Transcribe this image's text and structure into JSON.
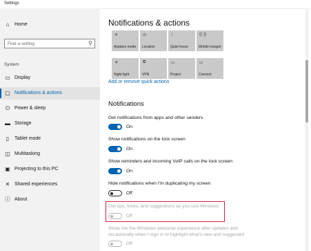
{
  "window": {
    "title": "Settings"
  },
  "sidebar": {
    "home": {
      "label": "Home",
      "icon": "home-icon"
    },
    "search": {
      "placeholder": "Find a setting",
      "icon": "search-icon"
    },
    "section": "System",
    "items": [
      {
        "label": "Display",
        "icon": "display-icon"
      },
      {
        "label": "Notifications & actions",
        "icon": "notifications-icon",
        "selected": true
      },
      {
        "label": "Power & sleep",
        "icon": "power-icon"
      },
      {
        "label": "Storage",
        "icon": "storage-icon"
      },
      {
        "label": "Tablet mode",
        "icon": "tablet-mode-icon"
      },
      {
        "label": "Multitasking",
        "icon": "multitasking-icon"
      },
      {
        "label": "Projecting to this PC",
        "icon": "projecting-icon"
      },
      {
        "label": "Shared experiences",
        "icon": "shared-experiences-icon"
      },
      {
        "label": "About",
        "icon": "about-icon"
      }
    ]
  },
  "main": {
    "title": "Notifications & actions",
    "quick_actions": [
      {
        "label": "Airplane mode",
        "icon": "airplane-icon"
      },
      {
        "label": "Location",
        "icon": "location-icon"
      },
      {
        "label": "Quiet hours",
        "icon": "moon-icon"
      },
      {
        "label": "Mobile hotspot",
        "icon": "hotspot-icon"
      },
      {
        "label": "Night light",
        "icon": "night-light-icon"
      },
      {
        "label": "VPN",
        "icon": "vpn-icon"
      },
      {
        "label": "Project",
        "icon": "project-icon"
      },
      {
        "label": "Connect",
        "icon": "connect-icon"
      }
    ],
    "quick_actions_link": "Add or remove quick actions",
    "notifications_heading": "Notifications",
    "settings": [
      {
        "label": "Get notifications from apps and other senders",
        "state": "On"
      },
      {
        "label": "Show notifications on the lock screen",
        "state": "On"
      },
      {
        "label": "Show reminders and incoming VoIP calls on the lock screen",
        "state": "On"
      },
      {
        "label": "Hide notifications when I'm duplicating my screen",
        "state": "Off"
      },
      {
        "label": "Get tips, tricks, and suggestions as you use Windows",
        "state": "Off",
        "disabled": true
      },
      {
        "label": "Show me the Windows welcome experience after updates and",
        "label2": "occasionally when I sign in to highlight what's new and suggested",
        "state": "Off",
        "disabled": true
      }
    ]
  },
  "colors": {
    "accent": "#0063b1",
    "highlight": "#e01b3c",
    "sidebar_bg": "#f2f2f2"
  }
}
